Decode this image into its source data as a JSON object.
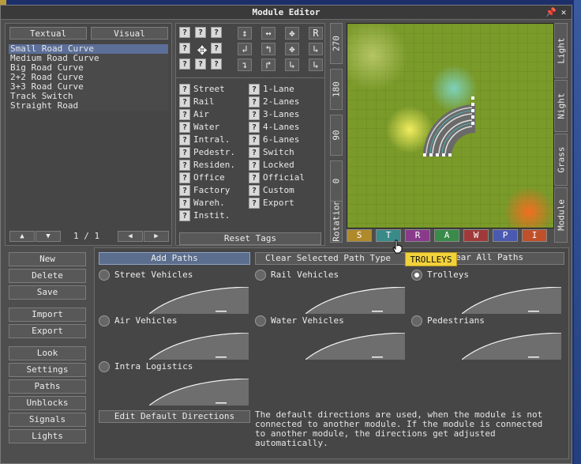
{
  "window": {
    "title": "Module Editor",
    "pin_glyph": "📌",
    "close_glyph": "✕"
  },
  "tabs": {
    "textual": "Textual",
    "visual": "Visual"
  },
  "modules": [
    "Small Road Curve",
    "Medium Road Curve",
    "Big Road Curve",
    "2+2 Road Curve",
    "3+3 Road Curve",
    "Track Switch",
    "Straight Road"
  ],
  "pager": {
    "up": "▲",
    "down": "▼",
    "page": "1 / 1",
    "prev": "◀",
    "next": "▶"
  },
  "tags_left": [
    "Street",
    "Rail",
    "Air",
    "Water",
    "Intral.",
    "Pedestr.",
    "Residen.",
    "Office",
    "Factory",
    "Wareh.",
    "Instit."
  ],
  "tags_right": [
    "1-Lane",
    "2-Lanes",
    "3-Lanes",
    "4-Lanes",
    "6-Lanes",
    "Switch",
    "Locked",
    "Official",
    "Custom",
    "Export"
  ],
  "q_glyph": "?",
  "reset_tags": "Reset Tags",
  "rotation": {
    "label": "Rotation:",
    "values": [
      "270",
      "180",
      "90",
      "0"
    ]
  },
  "view_tabs": [
    "Light",
    "Night",
    "Grass",
    "Module"
  ],
  "chips": [
    {
      "label": "S",
      "color": "#b08a2a"
    },
    {
      "label": "T",
      "color": "#3a8a8a"
    },
    {
      "label": "R",
      "color": "#8a3a8a"
    },
    {
      "label": "A",
      "color": "#3a8a4a"
    },
    {
      "label": "W",
      "color": "#a03a3a"
    },
    {
      "label": "P",
      "color": "#4a5ab0"
    },
    {
      "label": "I",
      "color": "#c0502a"
    }
  ],
  "side_buttons": [
    "New",
    "Delete",
    "Save",
    "Import",
    "Export",
    "Look",
    "Settings",
    "Paths",
    "Unblocks",
    "Signals",
    "Lights"
  ],
  "paths_toolbar": {
    "add": "Add Paths",
    "clear_selected": "Clear Selected Path Type",
    "clear_all": "ear All Paths",
    "tooltip": "TROLLEYS"
  },
  "path_types": [
    "Street Vehicles",
    "Rail Vehicles",
    "Trolleys",
    "Air Vehicles",
    "Water Vehicles",
    "Pedestrians",
    "Intra Logistics"
  ],
  "selected_path_type": "Trolleys",
  "directions": {
    "button": "Edit Default Directions",
    "help_lines": [
      "The default directions are used, when the module is not",
      "connected to another module. If the module is connected",
      "to another module, the directions get adjusted",
      "automatically."
    ]
  }
}
